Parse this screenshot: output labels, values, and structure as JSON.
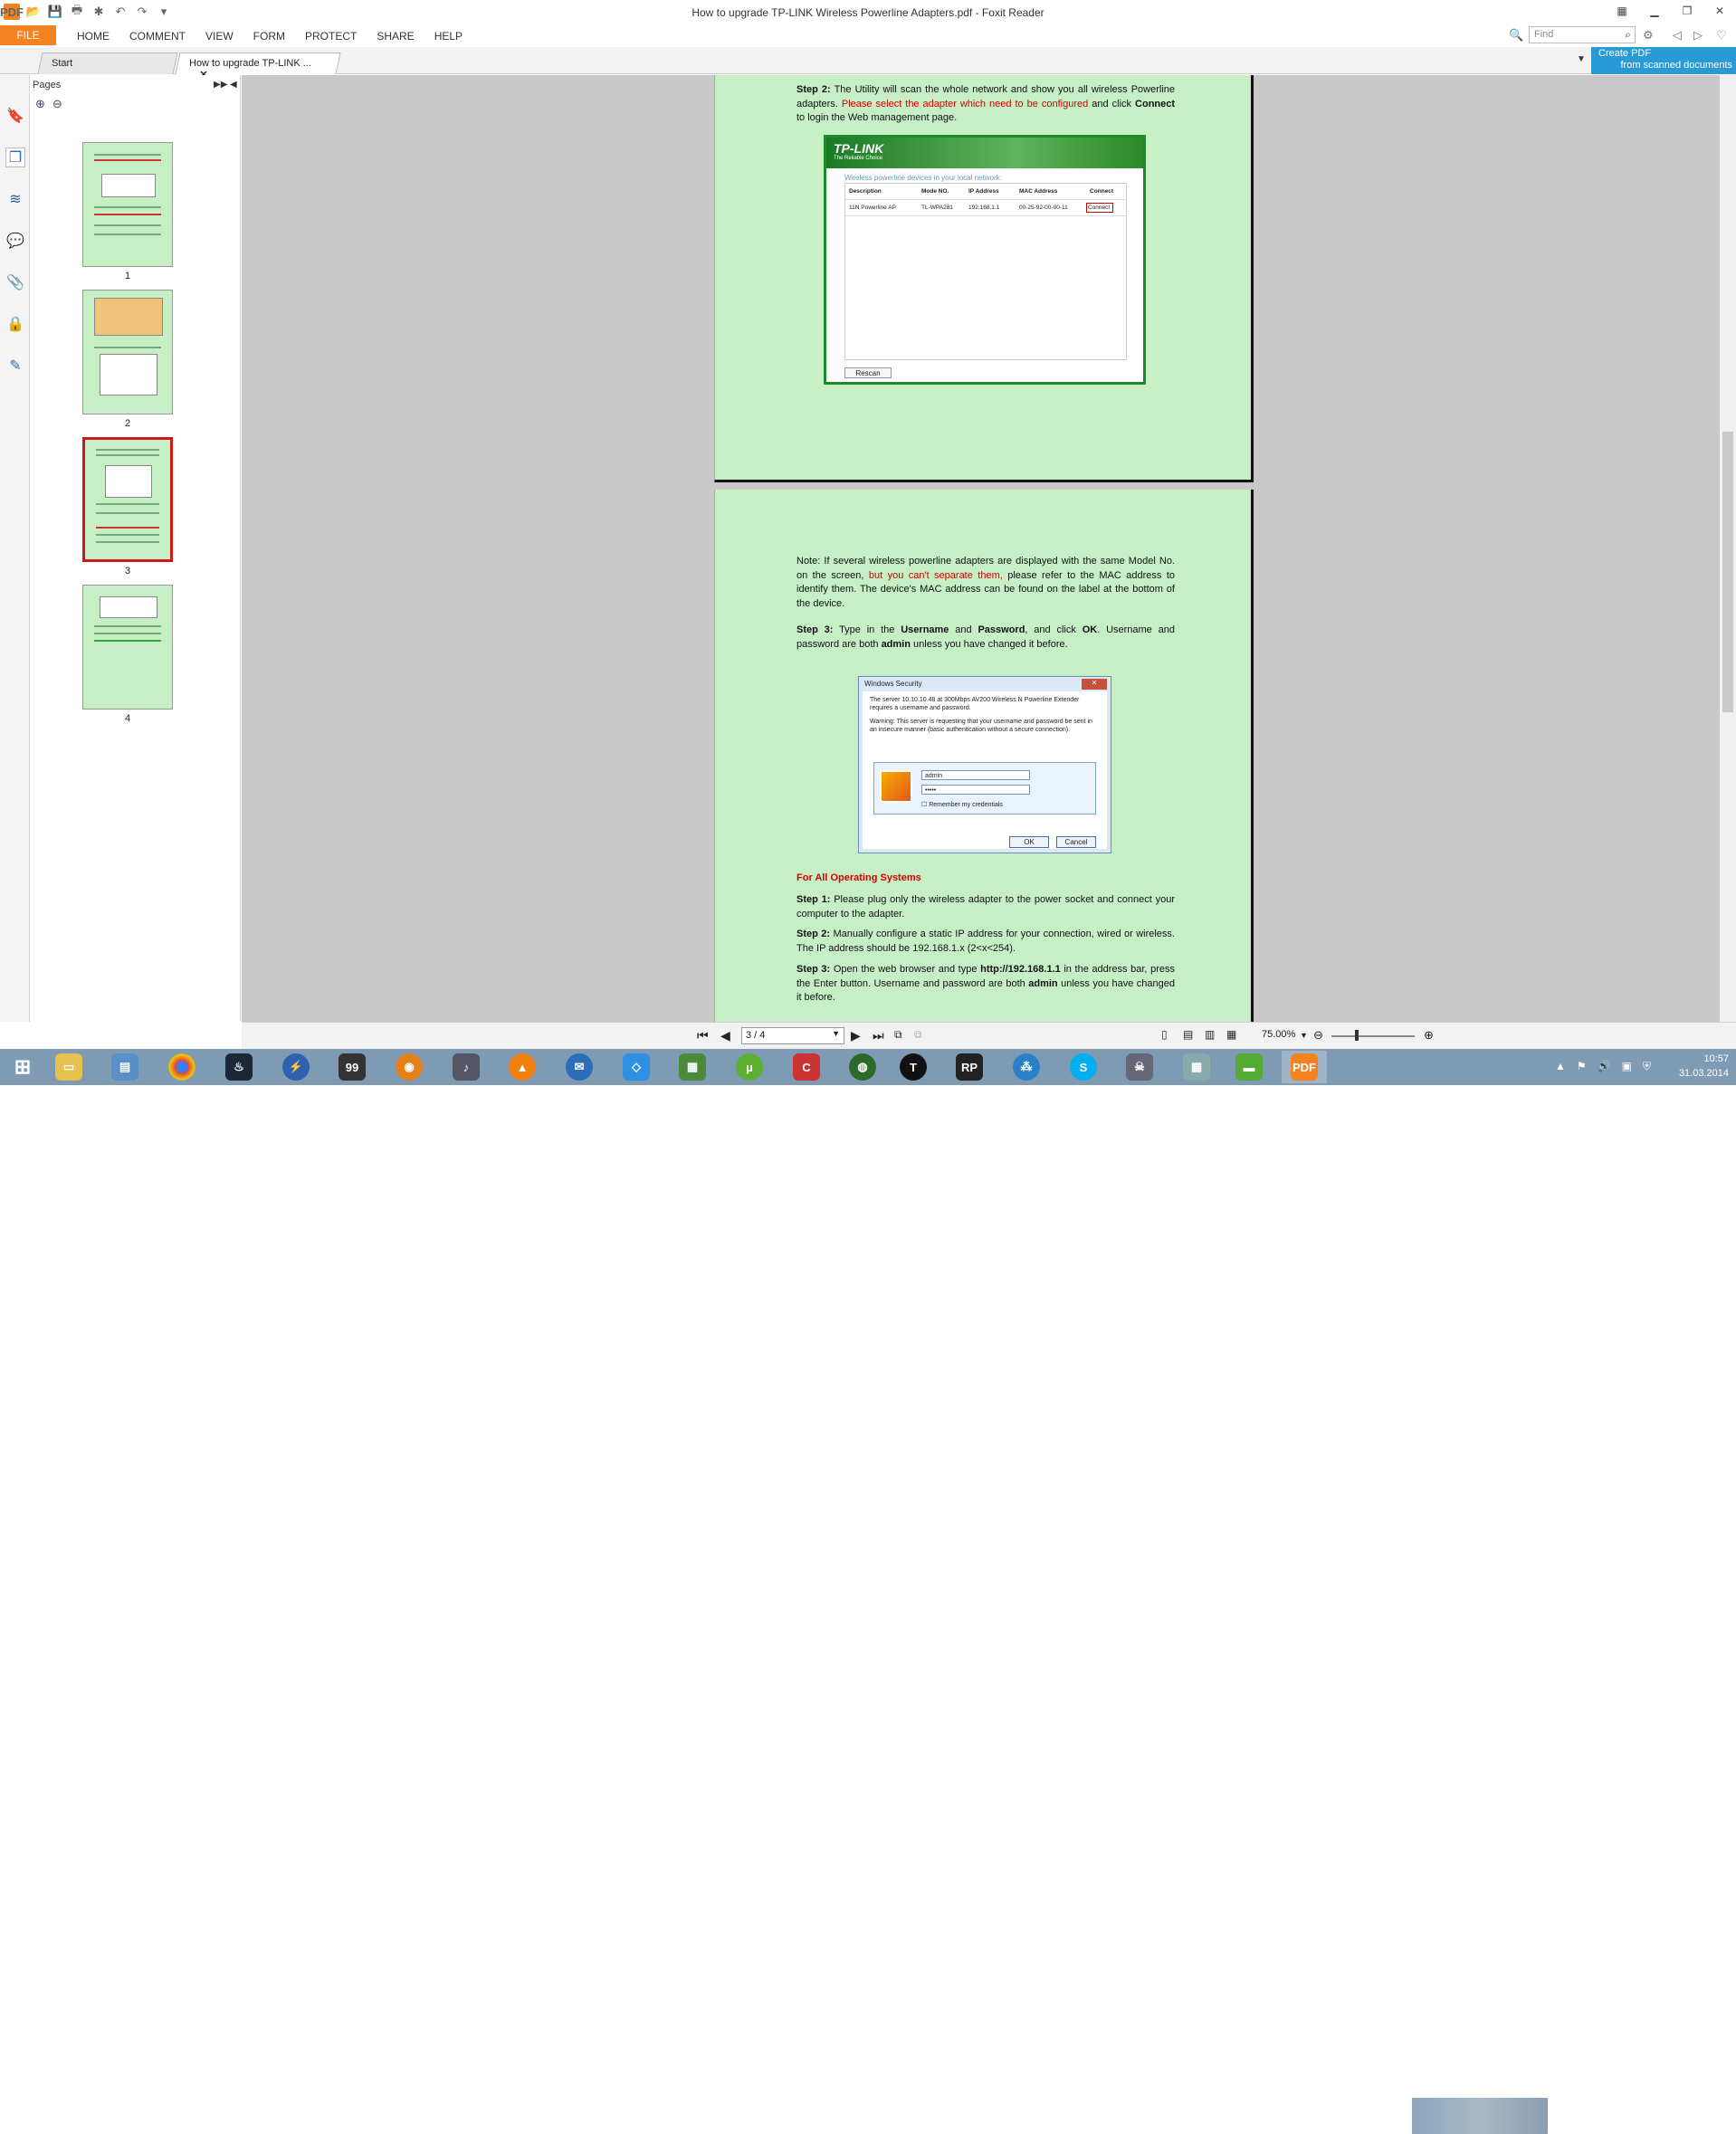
{
  "window": {
    "title": "How to upgrade TP-LINK Wireless Powerline Adapters.pdf - Foxit Reader"
  },
  "menu": {
    "file": "FILE",
    "items": [
      "HOME",
      "COMMENT",
      "VIEW",
      "FORM",
      "PROTECT",
      "SHARE",
      "HELP"
    ]
  },
  "find": {
    "placeholder": "Find"
  },
  "tabs": {
    "start": "Start",
    "doc": "How to upgrade TP-LINK ..."
  },
  "promo": {
    "line1": "Create PDF",
    "line2": "from scanned documents"
  },
  "pages_panel": {
    "title": "Pages",
    "thumbs": [
      "1",
      "2",
      "3",
      "4"
    ],
    "selected": "3"
  },
  "doc": {
    "step2_label": "Step 2:",
    "step2_a": "The Utility will scan the whole network and show you all wireless Powerline adapters.",
    "step2_red": "Please select the adapter which need to be configured",
    "step2_b": "and click",
    "step2_connect": "Connect",
    "step2_c": "to login the Web management page.",
    "tplink": {
      "logo": "TP-LINK",
      "tagline": "The Reliable Choice",
      "caption": "Wireless powerline devices in your local network:",
      "headers": [
        "Description",
        "Mode NO.",
        "IP Address",
        "MAC Address",
        "Connect"
      ],
      "row": [
        "11N Powerline AP",
        "TL-WPA281",
        "192.168.1.1",
        "00-25-92-00-00-11",
        "Connect"
      ],
      "rescan": "Rescan"
    },
    "note_a": "Note: If several wireless powerline adapters are displayed with the same Model No. on the screen,",
    "note_red": "but you can't separate them,",
    "note_b": "please refer to the MAC address to identify them. The device's MAC address can be found on the label at the bottom of the device.",
    "step3_label": "Step 3:",
    "step3_a": "Type in the",
    "step3_user": "Username",
    "step3_and": "and",
    "step3_pass": "Password",
    "step3_b": ", and click",
    "step3_ok": "OK",
    "step3_c": ". Username and password are both",
    "step3_admin": "admin",
    "step3_d": "unless you have changed it before.",
    "winsec": {
      "title": "Windows Security",
      "close": "✕",
      "p1": "The server 10.10.10.48 at 300Mbps AV200 Wireless N Powerline Extender requires a username and password.",
      "p2": "Warning: This server is requesting that your username and password be sent in an insecure manner (basic authentication without a secure connection).",
      "user": "admin",
      "pass": "•••••",
      "remember": "Remember my credentials",
      "ok": "OK",
      "cancel": "Cancel"
    },
    "all_os": "For All Operating Systems",
    "s1_label": "Step 1:",
    "s1": "Please plug only the wireless adapter to the power socket and connect your computer to the adapter.",
    "s2_label": "Step 2:",
    "s2": "Manually configure a static IP address for your connection, wired or wireless. The IP address should be 192.168.1.x (2<x<254).",
    "s3_label": "Step 3:",
    "s3_a": "Open the web browser and type",
    "s3_url": "http://192.168.1.1",
    "s3_b": "in the address bar, press the Enter button. Username and password are both",
    "s3_admin": "admin",
    "s3_c": "unless you have changed it before."
  },
  "nav": {
    "page_value": "3 / 4",
    "zoom": "75.00%"
  },
  "taskbar": {
    "time": "10:57",
    "date": "31.03.2014",
    "apps": [
      "start-icon",
      "explorer-icon",
      "control-panel-icon",
      "chrome-icon",
      "steam-icon",
      "flash-icon",
      "winamp-icon",
      "firefox-icon",
      "music-icon",
      "vlc-icon",
      "thunderbird-icon",
      "dropbox-icon",
      "notepad-icon",
      "utorrent-icon",
      "ccleaner-icon",
      "earth-icon",
      "t-app-icon",
      "rp-app-icon",
      "media-icon",
      "skype-icon",
      "alien-icon",
      "calculator-icon",
      "tray-app-icon",
      "foxit-icon"
    ]
  },
  "colors": {
    "accent_orange": "#f58220",
    "page_green": "#c6efc6",
    "highlight_red": "#d40000",
    "taskbar": "#7f9bb3"
  }
}
